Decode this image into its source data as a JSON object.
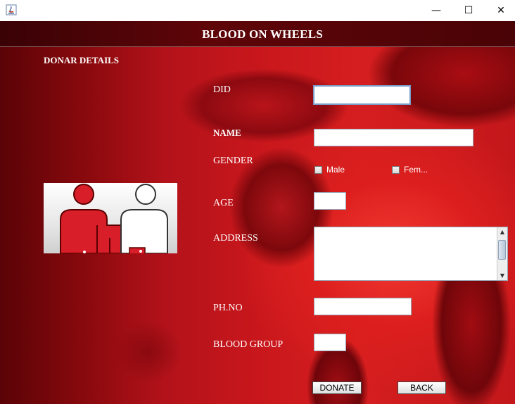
{
  "window": {
    "controls": {
      "minimize": "—",
      "maximize": "☐",
      "close": "✕"
    }
  },
  "header": {
    "title": "BLOOD ON WHEELS"
  },
  "section": {
    "title": "DONAR DETAILS"
  },
  "form": {
    "did_label": "DID",
    "name_label": "NAME",
    "gender_label": "GENDER",
    "gender_options": [
      "Male",
      "Fem..."
    ],
    "age_label": "AGE",
    "address_label": "ADDRESS",
    "phone_label": "PH.NO",
    "blood_group_label": "BLOOD GROUP",
    "scroll_up": "▲",
    "scroll_down": "▼"
  },
  "buttons": {
    "donate": "DONATE",
    "back": "BACK"
  },
  "colors": {
    "accent": "#c8171c",
    "header": "#4a0306"
  }
}
